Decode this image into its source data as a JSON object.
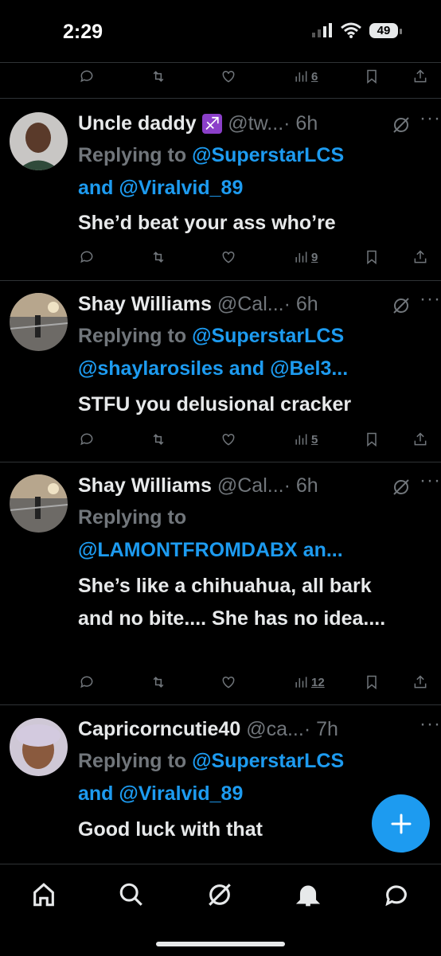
{
  "status_bar": {
    "time": "2:29",
    "battery": "49"
  },
  "top_actions": {
    "views": "6"
  },
  "tweets": [
    {
      "name": "Uncle daddy",
      "emoji": "♐",
      "handle": "@tw...",
      "time": "· 6h",
      "reply_prefix": "Replying to ",
      "reply_line1": "@SuperstarLCS",
      "reply_and": "and ",
      "reply_line2": "@Viralvid_89",
      "text": "She’d beat your ass who’re",
      "views": "9"
    },
    {
      "name": "Shay Williams",
      "handle": "@Cal...",
      "time": "· 6h",
      "reply_prefix": "Replying to ",
      "reply_line1": "@SuperstarLCS",
      "reply_line2a": "@shaylarosiles",
      "reply_and": " and ",
      "reply_line2b": "@Bel3...",
      "text": "STFU you delusional cracker",
      "views": "5"
    },
    {
      "name": "Shay Williams",
      "handle": "@Cal...",
      "time": "· 6h",
      "reply_prefix": "Replying to",
      "reply_line2": "@LAMONTFROMDABX an...",
      "text": "She’s like a chihuahua, all bark and no bite.... She has no idea....",
      "views": "12"
    },
    {
      "name": "Capricorncutie40",
      "handle": "@ca...",
      "time": "· 7h",
      "reply_prefix": "Replying to ",
      "reply_line1": "@SuperstarLCS",
      "reply_and": "and ",
      "reply_line2": "@Viralvid_89",
      "text": "Good luck with that"
    }
  ],
  "colors": {
    "accent": "#1d9bf0",
    "muted": "#71767b",
    "text": "#e7e9ea",
    "background": "#000000"
  },
  "nav_icons": [
    "home-icon",
    "search-icon",
    "grok-icon",
    "notifications-icon",
    "messages-icon"
  ]
}
